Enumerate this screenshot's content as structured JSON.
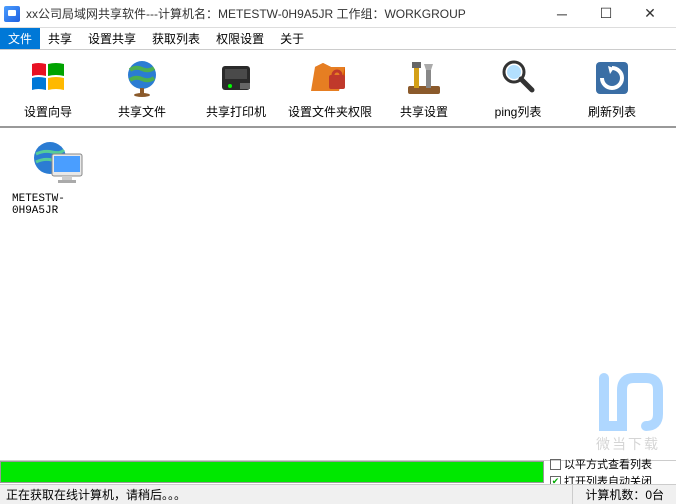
{
  "titlebar": {
    "text": "xx公司局域网共享软件---计算机名：METESTW-0H9A5JR  工作组：WORKGROUP"
  },
  "menu": {
    "items": [
      {
        "label": "文件",
        "active": true
      },
      {
        "label": "共享",
        "active": false
      },
      {
        "label": "设置共享",
        "active": false
      },
      {
        "label": "获取列表",
        "active": false
      },
      {
        "label": "权限设置",
        "active": false
      },
      {
        "label": "关于",
        "active": false
      }
    ]
  },
  "toolbar": {
    "items": [
      {
        "label": "设置向导",
        "icon": "windows-logo"
      },
      {
        "label": "共享文件",
        "icon": "globe"
      },
      {
        "label": "共享打印机",
        "icon": "printer"
      },
      {
        "label": "设置文件夹权限",
        "icon": "folder-lock"
      },
      {
        "label": "共享设置",
        "icon": "tools"
      },
      {
        "label": "ping列表",
        "icon": "magnifier"
      },
      {
        "label": "刷新列表",
        "icon": "refresh"
      }
    ]
  },
  "content": {
    "computers": [
      {
        "name": "METESTW-0H9A5JR"
      }
    ]
  },
  "options": {
    "chk1_label": "以平方式查看列表",
    "chk1_checked": false,
    "chk2_label": "打开列表自动关闭",
    "chk2_checked": true
  },
  "status": {
    "left": "正在获取在线计算机，请稍后。。。",
    "right": "计算机数：0台"
  },
  "watermark": {
    "text": "微当下载"
  }
}
